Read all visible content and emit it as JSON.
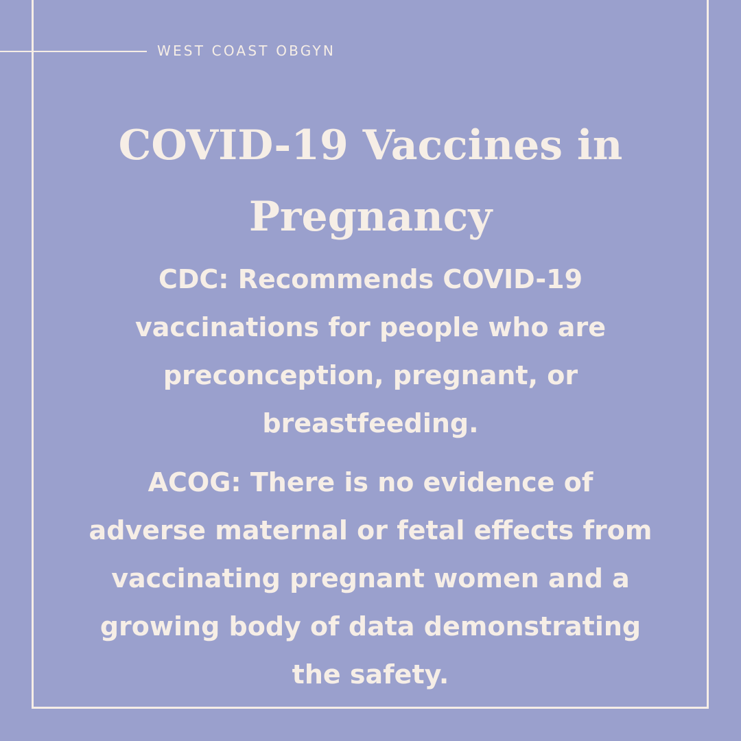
{
  "brand": "WEST COAST OBGYN",
  "title_line1": "COVID-19 Vaccines in",
  "title_line2": "Pregnancy",
  "cdc": {
    "lines": [
      "CDC: Recommends COVID-19",
      "vaccinations for people who are",
      "preconception, pregnant, or",
      "breastfeeding."
    ]
  },
  "acog": {
    "lines": [
      "ACOG: There is no evidence of",
      "adverse maternal or fetal effects from",
      "vaccinating pregnant women and a",
      "growing body of data demonstrating",
      "the safety."
    ]
  },
  "colors": {
    "background": "#9aa0cd",
    "text": "#f6eee6"
  }
}
